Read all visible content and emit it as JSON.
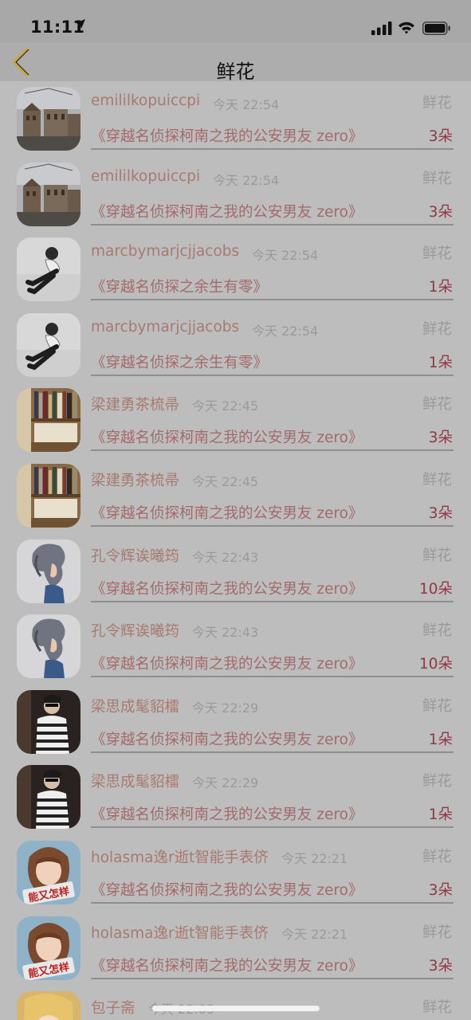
{
  "status_bar": {
    "time": "11:11"
  },
  "nav": {
    "title": "鲜花"
  },
  "rows": [
    {
      "user": "emililkopuiccpi",
      "time": "今天 22:54",
      "tag": "鲜花",
      "book": "《穿越名侦探柯南之我的公安男友 zero》",
      "count": "3朵",
      "avatar": "street"
    },
    {
      "user": "emililkopuiccpi",
      "time": "今天 22:54",
      "tag": "鲜花",
      "book": "《穿越名侦探柯南之我的公安男友 zero》",
      "count": "3朵",
      "avatar": "street"
    },
    {
      "user": "marcbymarjcjjacobs",
      "time": "今天 22:54",
      "tag": "鲜花",
      "book": "《穿越名侦探之余生有零》",
      "count": "1朵",
      "avatar": "sitting"
    },
    {
      "user": "marcbymarjcjjacobs",
      "time": "今天 22:54",
      "tag": "鲜花",
      "book": "《穿越名侦探之余生有零》",
      "count": "1朵",
      "avatar": "sitting"
    },
    {
      "user": "梁建勇茶梳帚",
      "time": "今天 22:45",
      "tag": "鲜花",
      "book": "《穿越名侦探柯南之我的公安男友 zero》",
      "count": "3朵",
      "avatar": "books"
    },
    {
      "user": "梁建勇茶梳帚",
      "time": "今天 22:45",
      "tag": "鲜花",
      "book": "《穿越名侦探柯南之我的公安男友 zero》",
      "count": "3朵",
      "avatar": "books"
    },
    {
      "user": "孔令辉诶曦筠",
      "time": "今天 22:43",
      "tag": "鲜花",
      "book": "《穿越名侦探柯南之我的公安男友 zero》",
      "count": "10朵",
      "avatar": "girl"
    },
    {
      "user": "孔令辉诶曦筠",
      "time": "今天 22:43",
      "tag": "鲜花",
      "book": "《穿越名侦探柯南之我的公安男友 zero》",
      "count": "10朵",
      "avatar": "girl"
    },
    {
      "user": "梁思成髦貂檑",
      "time": "今天 22:29",
      "tag": "鲜花",
      "book": "《穿越名侦探柯南之我的公安男友 zero》",
      "count": "1朵",
      "avatar": "stripes"
    },
    {
      "user": "梁思成髦貂檑",
      "time": "今天 22:29",
      "tag": "鲜花",
      "book": "《穿越名侦探柯南之我的公安男友 zero》",
      "count": "1朵",
      "avatar": "stripes"
    },
    {
      "user": "holasma逸r逝t智能手表侪",
      "time": "今天 22:21",
      "tag": "鲜花",
      "book": "《穿越名侦探柯南之我的公安男友 zero》",
      "count": "3朵",
      "avatar": "cartoon"
    },
    {
      "user": "holasma逸r逝t智能手表侪",
      "time": "今天 22:21",
      "tag": "鲜花",
      "book": "《穿越名侦探柯南之我的公安男友 zero》",
      "count": "3朵",
      "avatar": "cartoon"
    },
    {
      "user": "包子斋",
      "time": "今天 22:09",
      "tag": "鲜花",
      "book": "",
      "count": "",
      "avatar": "yellow"
    }
  ],
  "icons": {
    "back": "chevron-left-icon",
    "signal": "cellular-signal-icon",
    "wifi": "wifi-icon",
    "battery": "battery-icon",
    "location": "location-arrow-icon"
  }
}
